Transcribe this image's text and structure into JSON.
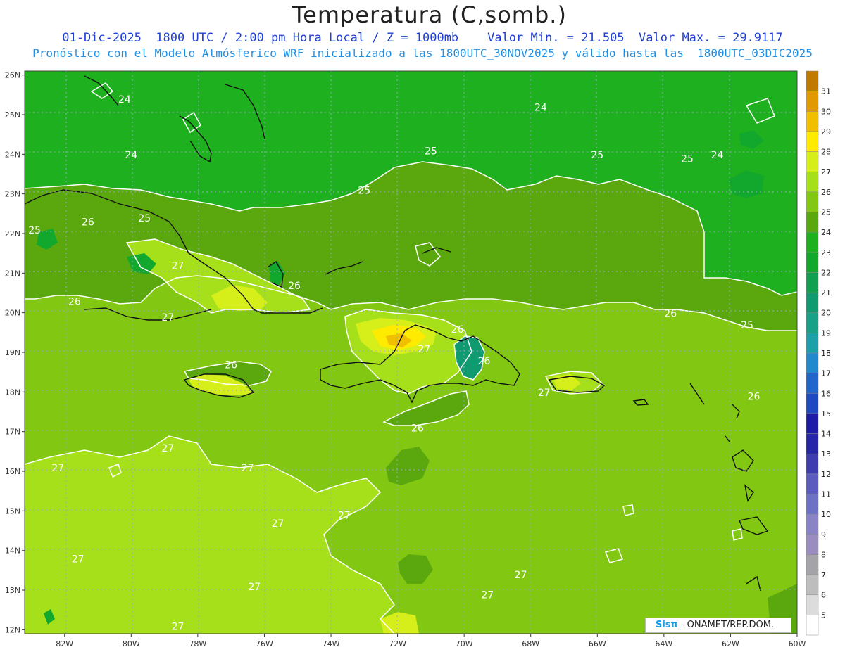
{
  "title": "Temperatura (C,somb.)",
  "subtitle_line1": "01-Dic-2025  1800 UTC / 2:00 pm Hora Local / Z = 1000mb    Valor Min. = 21.505  Valor Max. = 29.9117",
  "subtitle_line2": "Pronóstico con el Modelo Atmósferico WRF inicializado a las 1800UTC_30NOV2025 y válido hasta las  1800UTC_03DIC2025",
  "credit": {
    "logo": "Sisπ",
    "text": "- ONAMET/REP.DOM."
  },
  "chart_data": {
    "type": "heatmap",
    "variable": "Temperatura (C)",
    "level": "1000mb",
    "min": 21.505,
    "max": 29.9117,
    "lon_ticks": [
      "82W",
      "80W",
      "78W",
      "76W",
      "74W",
      "72W",
      "70W",
      "68W",
      "66W",
      "64W",
      "62W",
      "60W"
    ],
    "lat_ticks": [
      "26N",
      "25N",
      "24N",
      "23N",
      "22N",
      "21N",
      "20N",
      "19N",
      "18N",
      "17N",
      "16N",
      "15N",
      "14N",
      "13N",
      "12N"
    ],
    "lon_range": [
      -83.2,
      -60
    ],
    "lat_range": [
      11.9,
      26.1
    ],
    "colorbar": {
      "levels": [
        5,
        6,
        7,
        8,
        9,
        10,
        11,
        12,
        13,
        14,
        15,
        16,
        17,
        18,
        19,
        20,
        21,
        22,
        23,
        24,
        25,
        26,
        27,
        28,
        29,
        30,
        31
      ],
      "colors": [
        "#ffffff",
        "#dcdcdc",
        "#bdbdbd",
        "#a3a3a8",
        "#9b8cc0",
        "#8a84c6",
        "#6e72c4",
        "#5c5cbe",
        "#3d3db0",
        "#2626a8",
        "#1c1ca6",
        "#2048c0",
        "#2266cc",
        "#2289cc",
        "#1ea0a8",
        "#18a088",
        "#109a70",
        "#10a050",
        "#12a82e",
        "#1eb01e",
        "#5aa80e",
        "#82c812",
        "#a6e01a",
        "#d6ef1a",
        "#ffeb00",
        "#f0bf00",
        "#e09a00",
        "#c07a00"
      ],
      "colors_note": "colors correspond to bands below 5, 5-6, ... ,30-31, above 31"
    },
    "contour_labels": [
      {
        "text": "24",
        "lon": -80.2,
        "lat": 25.3
      },
      {
        "text": "24",
        "lon": -80.0,
        "lat": 23.9
      },
      {
        "text": "24",
        "lon": -67.7,
        "lat": 25.1
      },
      {
        "text": "24",
        "lon": -62.4,
        "lat": 23.9
      },
      {
        "text": "25",
        "lon": -73.0,
        "lat": 23.0
      },
      {
        "text": "25",
        "lon": -71.0,
        "lat": 24.0
      },
      {
        "text": "25",
        "lon": -66.0,
        "lat": 23.9
      },
      {
        "text": "25",
        "lon": -63.3,
        "lat": 23.8
      },
      {
        "text": "25",
        "lon": -79.6,
        "lat": 22.3
      },
      {
        "text": "25",
        "lon": -82.9,
        "lat": 22.0
      },
      {
        "text": "25",
        "lon": -61.5,
        "lat": 19.6
      },
      {
        "text": "26",
        "lon": -81.3,
        "lat": 22.2
      },
      {
        "text": "26",
        "lon": -81.7,
        "lat": 20.2
      },
      {
        "text": "26",
        "lon": -77.0,
        "lat": 18.6
      },
      {
        "text": "26",
        "lon": -75.1,
        "lat": 20.6
      },
      {
        "text": "26",
        "lon": -70.2,
        "lat": 19.5
      },
      {
        "text": "26",
        "lon": -69.4,
        "lat": 18.7
      },
      {
        "text": "26",
        "lon": -63.8,
        "lat": 19.9
      },
      {
        "text": "26",
        "lon": -61.3,
        "lat": 17.8
      },
      {
        "text": "26",
        "lon": -71.4,
        "lat": 17.0
      },
      {
        "text": "27",
        "lon": -78.6,
        "lat": 21.1
      },
      {
        "text": "27",
        "lon": -78.9,
        "lat": 19.8
      },
      {
        "text": "27",
        "lon": -71.2,
        "lat": 19.0
      },
      {
        "text": "27",
        "lon": -67.6,
        "lat": 17.9
      },
      {
        "text": "27",
        "lon": -78.9,
        "lat": 16.5
      },
      {
        "text": "27",
        "lon": -82.2,
        "lat": 16.0
      },
      {
        "text": "27",
        "lon": -76.5,
        "lat": 16.0
      },
      {
        "text": "27",
        "lon": -75.6,
        "lat": 14.6
      },
      {
        "text": "27",
        "lon": -73.6,
        "lat": 14.8
      },
      {
        "text": "27",
        "lon": -81.6,
        "lat": 13.7
      },
      {
        "text": "27",
        "lon": -76.3,
        "lat": 13.0
      },
      {
        "text": "27",
        "lon": -69.3,
        "lat": 12.8
      },
      {
        "text": "27",
        "lon": -68.3,
        "lat": 13.3
      },
      {
        "text": "27",
        "lon": -78.6,
        "lat": 12.0
      }
    ]
  }
}
